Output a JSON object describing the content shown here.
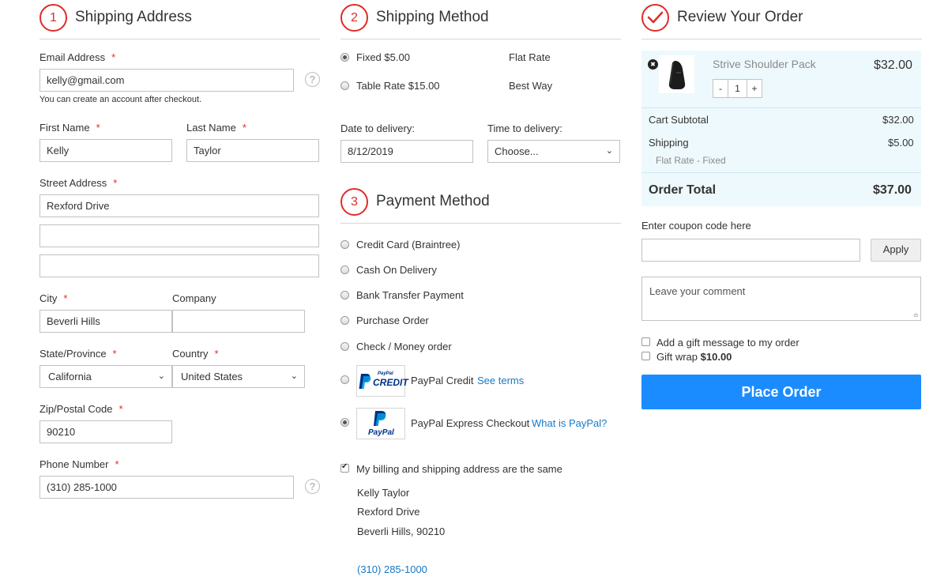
{
  "shipping_address": {
    "step": "1",
    "title": "Shipping Address",
    "email": {
      "label": "Email Address",
      "req": "*",
      "value": "kelly@gmail.com",
      "note": "You can create an account after checkout.",
      "help": "?"
    },
    "first_name": {
      "label": "First Name",
      "req": "*",
      "value": "Kelly"
    },
    "last_name": {
      "label": "Last Name",
      "req": "*",
      "value": "Taylor"
    },
    "street": {
      "label": "Street Address",
      "req": "*",
      "line1": "Rexford Drive",
      "line2": "",
      "line3": ""
    },
    "city": {
      "label": "City",
      "req": "*",
      "value": "Beverli Hills"
    },
    "company": {
      "label": "Company",
      "value": ""
    },
    "state": {
      "label": "State/Province",
      "req": "*",
      "value": "California"
    },
    "country": {
      "label": "Country",
      "req": "*",
      "value": "United States"
    },
    "zip": {
      "label": "Zip/Postal Code",
      "req": "*",
      "value": "90210"
    },
    "phone": {
      "label": "Phone Number",
      "req": "*",
      "value": "(310) 285-1000",
      "help": "?"
    }
  },
  "shipping_method": {
    "step": "2",
    "title": "Shipping Method",
    "options": [
      {
        "price_label": "Fixed $5.00",
        "carrier": "Flat Rate",
        "selected": true
      },
      {
        "price_label": "Table Rate $15.00",
        "carrier": "Best Way",
        "selected": false
      }
    ],
    "date_label": "Date to delivery:",
    "date_value": "8/12/2019",
    "time_label": "Time to delivery:",
    "time_value": "Choose..."
  },
  "payment_method": {
    "step": "3",
    "title": "Payment Method",
    "options": [
      "Credit Card (Braintree)",
      "Cash On Delivery",
      "Bank Transfer Payment",
      "Purchase Order",
      "Check / Money order"
    ],
    "paypal_credit": {
      "label": "PayPal Credit",
      "link": "See terms",
      "logo_small": "PayPal",
      "logo_big": "CREDIT"
    },
    "paypal_express": {
      "label": "PayPal Express Checkout",
      "link": "What is PayPal?",
      "logo": "PayPal",
      "selected": true
    },
    "same_address_label": "My billing and shipping address are the same",
    "billing": {
      "name": "Kelly Taylor",
      "street": "Rexford Drive",
      "city_zip": "Beverli Hills, 90210",
      "phone": "(310) 285-1000"
    }
  },
  "review": {
    "title": "Review Your Order",
    "item": {
      "name": "Strive Shoulder Pack",
      "price": "$32.00",
      "qty": "1",
      "minus": "-",
      "plus": "+",
      "remove": "✖"
    },
    "subtotal_label": "Cart Subtotal",
    "subtotal_value": "$32.00",
    "shipping_label": "Shipping",
    "shipping_value": "$5.00",
    "shipping_method": "Flat Rate - Fixed",
    "total_label": "Order Total",
    "total_value": "$37.00",
    "coupon_label": "Enter coupon code here",
    "coupon_value": "",
    "apply_label": "Apply",
    "comment_placeholder": "Leave your comment",
    "gift_message_label": "Add a gift message to my order",
    "gift_wrap_label": "Gift wrap",
    "gift_wrap_price": "$10.00",
    "place_order_label": "Place Order"
  },
  "colors": {
    "accent_red": "#e02b27",
    "primary_button": "#1a8cff",
    "link": "#1979c3",
    "summary_bg": "#eef9fd"
  }
}
